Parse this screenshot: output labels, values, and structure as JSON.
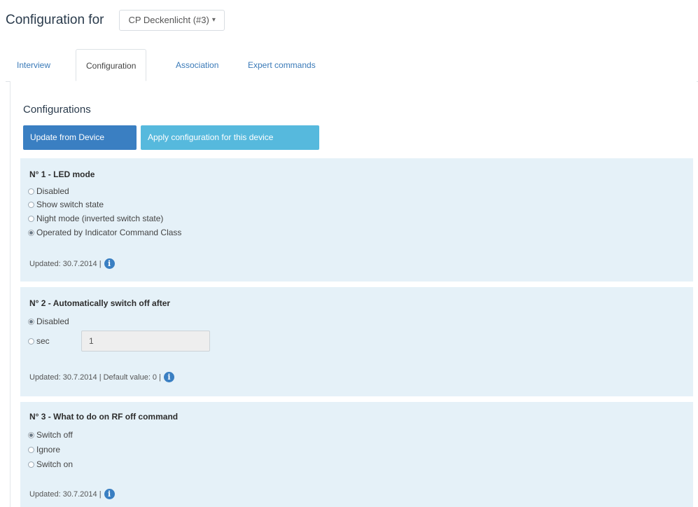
{
  "header": {
    "title": "Configuration for",
    "device_select": "CP Deckenlicht (#3)"
  },
  "tabs": [
    {
      "label": "Interview"
    },
    {
      "label": "Configuration"
    },
    {
      "label": "Association"
    },
    {
      "label": "Expert commands"
    }
  ],
  "configurations": {
    "title": "Configurations",
    "update_button": "Update from Device",
    "apply_button": "Apply configuration for this device"
  },
  "params": [
    {
      "title": "N° 1 - LED mode",
      "options": [
        {
          "label": "Disabled",
          "checked": false
        },
        {
          "label": "Show switch state",
          "checked": false
        },
        {
          "label": "Night mode (inverted switch state)",
          "checked": false
        },
        {
          "label": "Operated by Indicator Command Class",
          "checked": true
        }
      ],
      "updated": "Updated: 30.7.2014 |"
    },
    {
      "title": "N° 2 - Automatically switch off after",
      "options": [
        {
          "label": "Disabled",
          "checked": true
        },
        {
          "label": "sec",
          "checked": false
        }
      ],
      "sec_value": "1",
      "updated": "Updated: 30.7.2014 | Default value: 0 |"
    },
    {
      "title": "N° 3 - What to do on RF off command",
      "options": [
        {
          "label": "Switch off",
          "checked": true
        },
        {
          "label": "Ignore",
          "checked": false
        },
        {
          "label": "Switch on",
          "checked": false
        }
      ],
      "updated": "Updated: 30.7.2014 |"
    }
  ]
}
